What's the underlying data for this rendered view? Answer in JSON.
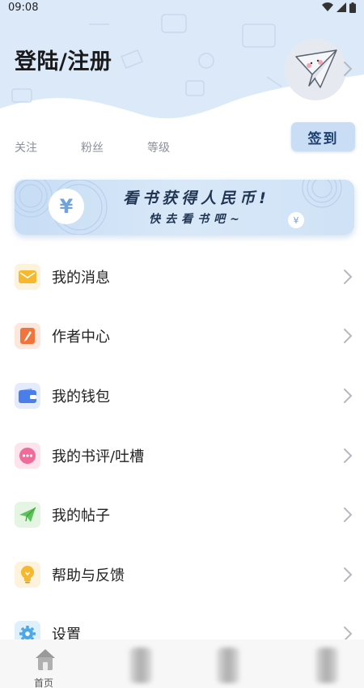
{
  "status_bar": {
    "time": "09:08"
  },
  "header": {
    "title": "登陆/注册"
  },
  "stats": [
    {
      "label": "关注"
    },
    {
      "label": "粉丝"
    },
    {
      "label": "等级"
    }
  ],
  "checkin": {
    "label": "签到"
  },
  "banner": {
    "title": "看书获得人民币!",
    "subtitle": "快去看书吧~",
    "coin_symbol": "¥"
  },
  "menu": [
    {
      "label": "我的消息",
      "icon": "mail-icon",
      "color": "#f5b82e"
    },
    {
      "label": "作者中心",
      "icon": "pen-icon",
      "color": "#f0743c"
    },
    {
      "label": "我的钱包",
      "icon": "wallet-icon",
      "color": "#4a7ee8"
    },
    {
      "label": "我的书评/吐槽",
      "icon": "comment-icon",
      "color": "#f06a9a"
    },
    {
      "label": "我的帖子",
      "icon": "paper-plane-icon",
      "color": "#5cc35a"
    },
    {
      "label": "帮助与反馈",
      "icon": "lightbulb-icon",
      "color": "#f5b82e"
    },
    {
      "label": "设置",
      "icon": "gear-icon",
      "color": "#4aa8e8"
    }
  ],
  "bottom_nav": {
    "home_label": "首页"
  },
  "colors": {
    "header_bg": "#dbe9f8",
    "accent": "#c9def5"
  }
}
